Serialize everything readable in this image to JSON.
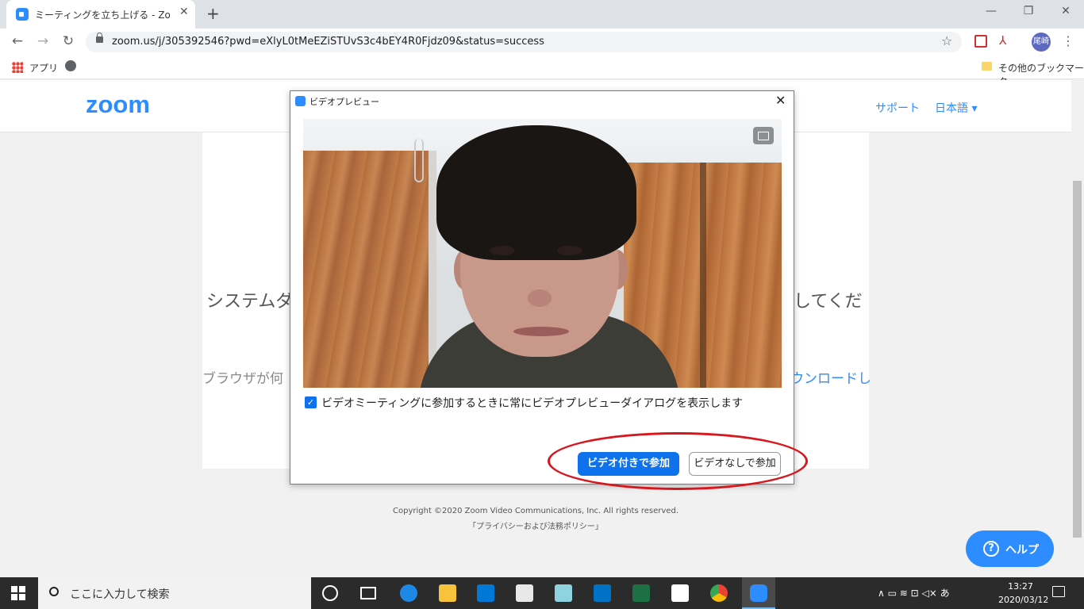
{
  "browser": {
    "tab_title": "ミーティングを立ち上げる - Zoom",
    "tab_close": "✕",
    "new_tab": "+",
    "url": "zoom.us/j/305392546?pwd=eXlyL0tMeEZiSTUvS3c4bEY4R0Fjdz09&status=success",
    "avatar_label": "尾崎",
    "bookmarks": {
      "apps": "アプリ",
      "other": "その他のブックマーク"
    },
    "icons": {
      "back": "←",
      "forward": "→",
      "reload": "↻",
      "star": "☆",
      "menu": "⋮",
      "min": "—",
      "restore": "❐",
      "close": "✕",
      "pdf": "⅄"
    }
  },
  "page": {
    "logo": "zoom",
    "nav": {
      "support": "サポート",
      "language": "日本語 ▾"
    },
    "system_text_left": "システムダ",
    "system_text_right": "してくだ",
    "browser_text_left": "ブラウザが何",
    "browser_text_right": "ウンロードし",
    "copyright": "Copyright ©2020 Zoom Video Communications, Inc. All rights reserved.",
    "privacy": "「プライバシーおよび法務ポリシー」",
    "help": {
      "icon": "?",
      "label": "ヘルプ"
    }
  },
  "dialog": {
    "title": "ビデオプレビュー",
    "close": "✕",
    "checkbox_checked": true,
    "checkbox_mark": "✓",
    "checkbox_label": "ビデオミーティングに参加するときに常にビデオプレビューダイアログを表示します",
    "btn_join_with_video": "ビデオ付きで参加",
    "btn_join_without_video": "ビデオなしで参加"
  },
  "taskbar": {
    "search_placeholder": "ここに入力して検索",
    "tray": "∧  ▭  ≋  ⊡  ◁×  あ",
    "time": "13:27",
    "date": "2020/03/12"
  },
  "colors": {
    "zoom_blue": "#2d8cff",
    "button_blue": "#0e72ed",
    "annotation_red": "#d8161d"
  }
}
